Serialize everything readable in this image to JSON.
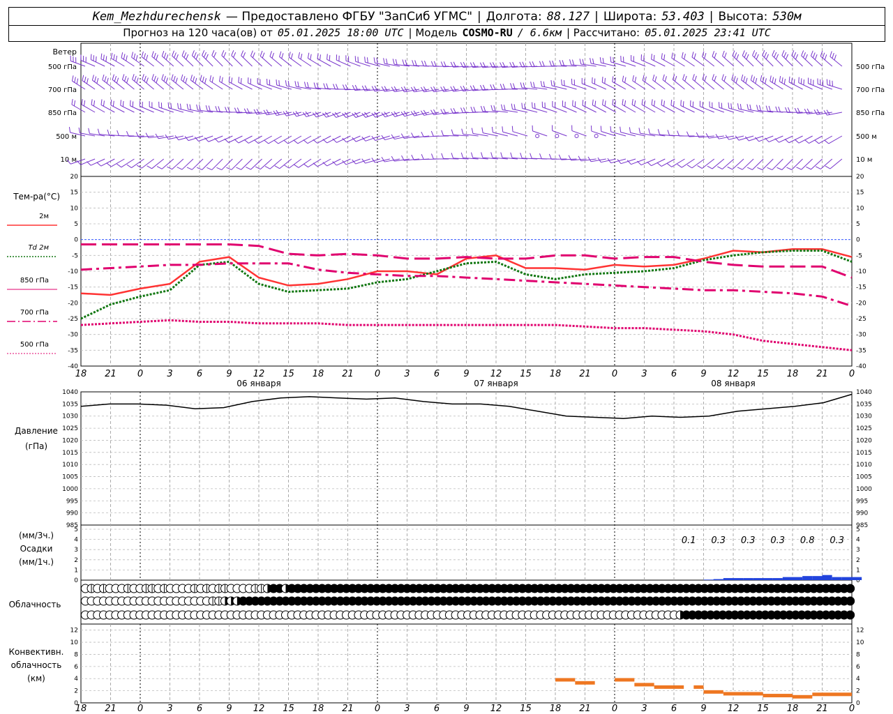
{
  "header": {
    "station": "Kem_Mezhdurechensk",
    "provider": "— Предоставлено ФГБУ \"ЗапСиб УГМС\"",
    "lon_label": "Долгота:",
    "lon_value": "88.127",
    "lat_label": "Широта:",
    "lat_value": "53.403",
    "alt_label": "Высота:",
    "alt_value": "530м",
    "forecast_label": "Прогноз на 120 часа(ов) от",
    "forecast_start": "05.01.2025 18:00 UTC",
    "model_label": "| Модель",
    "model_name": "COSMO-RU",
    "model_res": "/ 6.6км",
    "calc_label": "| Рассчитано:",
    "calc_time": "05.01.2025 23:41 UTC"
  },
  "panels": {
    "wind": {
      "title": "Ветер",
      "levels": [
        "500 гПа",
        "700 гПа",
        "850 гПа",
        "500 м",
        "10 м"
      ]
    },
    "temp": {
      "title": "Тем-ра(°С)",
      "legend": [
        {
          "label": "2м",
          "color": "#ff3333"
        },
        {
          "label": "Td 2м",
          "color": "#117711"
        },
        {
          "label": "850 гПа",
          "color": "#e0006e"
        },
        {
          "label": "700 гПа",
          "color": "#e0006e"
        },
        {
          "label": "500 гПа",
          "color": "#e0006e"
        }
      ]
    },
    "pressure": {
      "title_1": "Давление",
      "title_2": "(гПа)"
    },
    "precip": {
      "title_1": "(мм/3ч.)",
      "title_2": "Осадки",
      "title_3": "(мм/1ч.)",
      "totals": [
        "0.1",
        "0.3",
        "0.3",
        "0.3",
        "0.8",
        "0.3"
      ]
    },
    "cloud": {
      "title": "Облачность"
    },
    "convective": {
      "title_1": "Конвективн.",
      "title_2": "облачность",
      "title_3": "(км)"
    }
  },
  "axis": {
    "hour_ticks": [
      "18",
      "21",
      "0",
      "3",
      "6",
      "9",
      "12",
      "15",
      "18",
      "21",
      "0",
      "3",
      "6",
      "9",
      "12",
      "15",
      "18",
      "21",
      "0",
      "3",
      "6",
      "9",
      "12",
      "15",
      "18",
      "21",
      "0"
    ],
    "days": [
      "06 января",
      "07 января",
      "08 января"
    ]
  },
  "colors": {
    "wind": "#7733cc",
    "t2m": "#ff3333",
    "td2m": "#117711",
    "upper": "#e0006e",
    "pressure": "#000000",
    "precip": "#2244dd",
    "convective": "#ee7722",
    "zero_line": "#3355ff"
  },
  "chart_data": [
    {
      "type": "line",
      "title": "Тем-ра(°С)",
      "ylim": [
        -40,
        20
      ],
      "yticks": [
        20,
        15,
        10,
        5,
        0,
        -5,
        -10,
        -15,
        -20,
        -25,
        -30,
        -35,
        -40
      ],
      "x_hours": [
        0,
        3,
        6,
        9,
        12,
        15,
        18,
        21,
        24,
        27,
        30,
        33,
        36,
        39,
        42,
        45,
        48,
        51,
        54,
        57,
        60,
        63,
        66,
        69,
        72,
        75,
        78
      ],
      "series": [
        {
          "name": "2м",
          "style": "solid",
          "values": [
            -17,
            -17.5,
            -15.5,
            -14,
            -7,
            -5.5,
            -12,
            -14.5,
            -14,
            -12.5,
            -10,
            -10,
            -11,
            -6,
            -5,
            -9,
            -9,
            -9.5,
            -8,
            -8.5,
            -8,
            -6,
            -3.5,
            -4,
            -3,
            -3,
            -5.5
          ]
        },
        {
          "name": "Td 2м",
          "style": "dotted",
          "values": [
            -25,
            -20.5,
            -18,
            -16,
            -8,
            -7,
            -14,
            -16.5,
            -16,
            -15.5,
            -13.5,
            -12.5,
            -10,
            -7.5,
            -7,
            -11,
            -12.5,
            -11,
            -10.5,
            -10,
            -9,
            -6.5,
            -5,
            -4,
            -3.5,
            -3.5,
            -7
          ]
        },
        {
          "name": "850 гПа",
          "style": "long-dash",
          "values": [
            -1.5,
            -1.5,
            -1.5,
            -1.5,
            -1.5,
            -1.5,
            -2,
            -4.5,
            -5,
            -4.5,
            -5,
            -6,
            -6,
            -5.5,
            -6,
            -6,
            -5,
            -5,
            -6,
            -5.5,
            -5.5,
            -7,
            -8,
            -8.5,
            -8.5,
            -8.5,
            -12
          ]
        },
        {
          "name": "700 гПа",
          "style": "dash-dot",
          "values": [
            -9.5,
            -9,
            -8.5,
            -8,
            -8,
            -7.5,
            -7.5,
            -7.5,
            -9.5,
            -10.5,
            -11,
            -11.5,
            -11.5,
            -12,
            -12.5,
            -13,
            -13.5,
            -14,
            -14.5,
            -15,
            -15.5,
            -16,
            -16,
            -16.5,
            -17,
            -18,
            -21
          ]
        },
        {
          "name": "500 гПа",
          "style": "dotted",
          "values": [
            -27,
            -26.5,
            -26,
            -25.5,
            -26,
            -26,
            -26.5,
            -26.5,
            -26.5,
            -27,
            -27,
            -27,
            -27,
            -27,
            -27,
            -27,
            -27,
            -27.5,
            -28,
            -28,
            -28.5,
            -29,
            -30,
            -32,
            -33,
            -34,
            -35
          ]
        }
      ]
    },
    {
      "type": "line",
      "title": "Давление (гПа)",
      "ylim": [
        985,
        1040
      ],
      "yticks": [
        1040,
        1035,
        1030,
        1025,
        1020,
        1015,
        1010,
        1005,
        1000,
        995,
        990,
        985
      ],
      "x_hours": [
        0,
        3,
        6,
        9,
        12,
        15,
        18,
        21,
        24,
        27,
        30,
        33,
        36,
        39,
        42,
        45,
        48,
        51,
        54,
        57,
        60,
        63,
        66,
        69,
        72,
        75,
        78
      ],
      "series": [
        {
          "name": "pressure",
          "values": [
            1034,
            1035,
            1035,
            1034.5,
            1033,
            1033.5,
            1036,
            1037.5,
            1038,
            1037.5,
            1037,
            1037.5,
            1036,
            1035,
            1035,
            1034,
            1032,
            1030,
            1029.5,
            1029,
            1030,
            1029.5,
            1030,
            1032,
            1033,
            1034,
            1035.5,
            1039
          ]
        }
      ]
    },
    {
      "type": "bar",
      "title": "Осадки",
      "ylim": [
        0,
        5
      ],
      "yticks": [
        5,
        4,
        3,
        2,
        1,
        0
      ],
      "x_hours": [
        63,
        64,
        65,
        66,
        67,
        68,
        69,
        70,
        71,
        72,
        73,
        74,
        75,
        76,
        77,
        78
      ],
      "values": [
        0.05,
        0.1,
        0.2,
        0.2,
        0.2,
        0.2,
        0.2,
        0.2,
        0.3,
        0.3,
        0.4,
        0.4,
        0.5,
        0.3,
        0.3,
        0.3
      ]
    },
    {
      "type": "bar",
      "title": "Конвективн. облачность (км)",
      "ylim": [
        0,
        13
      ],
      "yticks": [
        12,
        10,
        8,
        6,
        4,
        2,
        0
      ],
      "segments": [
        {
          "from": 48,
          "to": 50,
          "height": 3.8
        },
        {
          "from": 50,
          "to": 52,
          "height": 3.3
        },
        {
          "from": 54,
          "to": 56,
          "height": 3.8
        },
        {
          "from": 56,
          "to": 58,
          "height": 3.0
        },
        {
          "from": 58,
          "to": 61,
          "height": 2.6
        },
        {
          "from": 62,
          "to": 63,
          "height": 2.6
        },
        {
          "from": 63,
          "to": 65,
          "height": 1.8
        },
        {
          "from": 65,
          "to": 69,
          "height": 1.5
        },
        {
          "from": 69,
          "to": 72,
          "height": 1.2
        },
        {
          "from": 72,
          "to": 74,
          "height": 1.0
        },
        {
          "from": 74,
          "to": 78,
          "height": 1.4
        }
      ]
    }
  ],
  "cloud_rows": {
    "top": [
      0,
      1,
      0,
      1,
      0,
      0,
      0,
      1,
      0,
      0,
      1,
      1,
      0,
      1,
      0,
      0,
      0,
      0,
      1,
      0,
      1,
      0,
      1,
      1,
      0,
      0,
      0,
      0,
      1,
      1,
      2,
      3,
      3,
      2,
      3,
      3,
      3,
      3,
      3,
      3,
      3,
      3,
      3,
      3,
      3,
      3,
      3,
      3,
      3,
      3,
      3,
      3,
      3,
      3,
      3,
      3,
      3,
      3,
      3,
      3,
      3,
      3,
      3,
      3,
      3,
      3,
      3,
      3,
      3,
      3,
      3,
      3,
      3,
      3,
      3,
      3,
      3,
      3,
      3,
      3,
      3,
      3,
      3,
      3,
      3,
      3,
      3,
      3,
      3,
      3,
      3,
      3,
      3,
      3,
      3,
      3,
      3,
      3,
      3,
      3,
      3,
      3,
      3,
      3,
      3,
      3,
      3,
      3,
      3,
      3,
      3,
      3,
      3,
      3,
      3,
      3,
      3,
      3,
      3,
      3,
      3,
      3,
      3,
      3,
      3,
      3,
      3
    ],
    "mid": [
      0,
      0,
      0,
      0,
      0,
      0,
      0,
      0,
      0,
      0,
      0,
      0,
      0,
      0,
      0,
      0,
      0,
      0,
      0,
      0,
      0,
      1,
      1,
      2,
      2,
      2,
      3,
      3,
      3,
      3,
      3,
      3,
      3,
      3,
      3,
      3,
      3,
      3,
      3,
      3,
      3,
      3,
      3,
      3,
      3,
      3,
      3,
      3,
      3,
      3,
      3,
      3,
      3,
      3,
      3,
      3,
      3,
      3,
      3,
      3,
      3,
      3,
      3,
      3,
      3,
      3,
      3,
      3,
      3,
      3,
      3,
      3,
      3,
      3,
      3,
      3,
      3,
      3,
      3,
      3,
      3,
      3,
      3,
      3,
      3,
      3,
      3,
      3,
      3,
      3,
      3,
      3,
      3,
      3,
      3,
      3,
      3,
      3,
      3,
      3,
      3,
      3,
      3,
      3,
      3,
      3,
      3,
      3,
      3,
      3,
      3,
      3,
      3,
      3,
      3,
      3,
      3,
      3,
      3,
      3,
      3,
      3,
      3,
      3,
      3,
      3,
      3
    ],
    "low": [
      0,
      0,
      0,
      0,
      0,
      0,
      0,
      0,
      0,
      0,
      0,
      0,
      0,
      0,
      0,
      0,
      0,
      0,
      0,
      0,
      0,
      0,
      0,
      0,
      0,
      0,
      0,
      0,
      0,
      0,
      0,
      0,
      0,
      0,
      0,
      0,
      0,
      0,
      0,
      0,
      0,
      0,
      0,
      0,
      0,
      0,
      0,
      0,
      0,
      0,
      0,
      0,
      0,
      0,
      0,
      0,
      0,
      0,
      0,
      0,
      0,
      0,
      0,
      0,
      0,
      0,
      0,
      0,
      0,
      0,
      0,
      0,
      0,
      0,
      0,
      0,
      0,
      0,
      0,
      0,
      0,
      0,
      0,
      0,
      0,
      0,
      0,
      0,
      0,
      0,
      0,
      0,
      0,
      0,
      0,
      0,
      0,
      0,
      2,
      3,
      3,
      3,
      3,
      3,
      3,
      3,
      3,
      3,
      3,
      3,
      3,
      3,
      3,
      3,
      3,
      3,
      3,
      3,
      3,
      3,
      3,
      3,
      3,
      3,
      3,
      3,
      3
    ]
  }
}
